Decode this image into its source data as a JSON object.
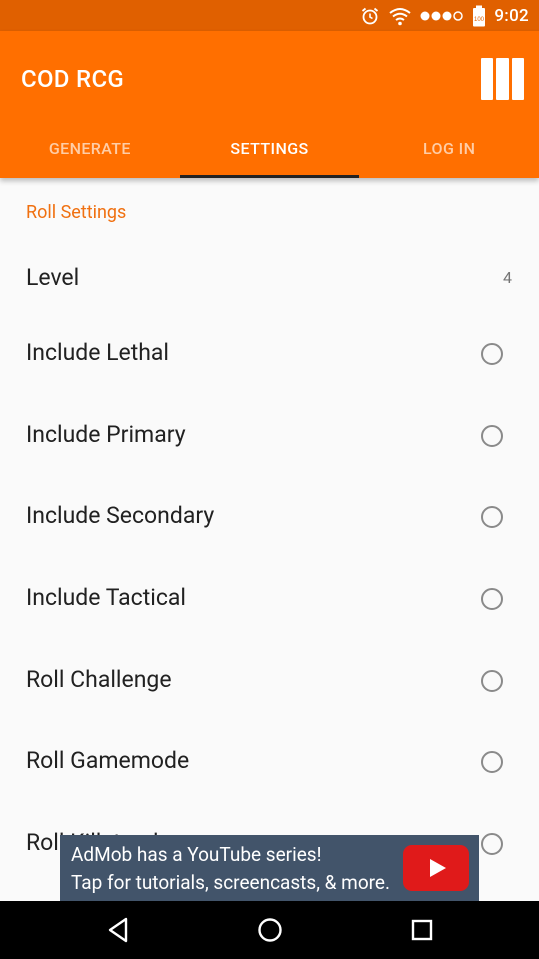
{
  "status_bar": {
    "time": "9:02",
    "battery_level": "100",
    "icons": [
      "alarm-icon",
      "wifi-icon",
      "signal-icon",
      "battery-icon"
    ],
    "color": "#e06000"
  },
  "app_bar": {
    "title": "COD RCG",
    "menu_icon": "menu-columns-icon",
    "color": "#ff6f00"
  },
  "tabs": [
    {
      "label": "GENERATE",
      "active": false
    },
    {
      "label": "SETTINGS",
      "active": true
    },
    {
      "label": "LOG IN",
      "active": false
    }
  ],
  "settings": {
    "section_title": "Roll Settings",
    "level": {
      "label": "Level",
      "value": "4"
    },
    "items": [
      {
        "label": "Include Lethal",
        "checked": false
      },
      {
        "label": "Include Primary",
        "checked": false
      },
      {
        "label": "Include Secondary",
        "checked": false
      },
      {
        "label": "Include Tactical",
        "checked": false
      },
      {
        "label": "Roll Challenge",
        "checked": false
      },
      {
        "label": "Roll Gamemode",
        "checked": false
      },
      {
        "label": "Roll Killstreaks",
        "checked": false
      }
    ],
    "accent_color": "#f07010"
  },
  "ad": {
    "line1": "AdMob has a YouTube series!",
    "line2": "Tap for tutorials, screencasts, & more.",
    "icon": "youtube-play-icon"
  },
  "nav_bar": {
    "buttons": [
      "back-icon",
      "home-icon",
      "recents-icon"
    ]
  }
}
